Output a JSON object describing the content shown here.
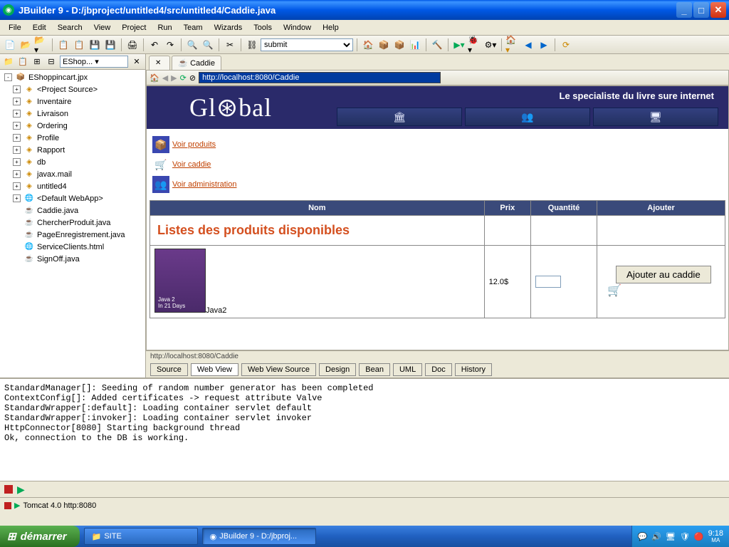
{
  "title": "JBuilder 9 - D:/jbproject/untitled4/src/untitled4/Caddie.java",
  "menu": [
    "File",
    "Edit",
    "Search",
    "View",
    "Project",
    "Run",
    "Team",
    "Wizards",
    "Tools",
    "Window",
    "Help"
  ],
  "combo_toolbar": "submit",
  "sidebar_combo": "EShop...",
  "tree": [
    {
      "exp": "-",
      "icon": "jar",
      "label": "EShoppincart.jpx"
    },
    {
      "exp": "+",
      "icon": "pkg",
      "label": "<Project Source>",
      "indent": 1
    },
    {
      "exp": "+",
      "icon": "pkg",
      "label": "Inventaire",
      "indent": 1
    },
    {
      "exp": "+",
      "icon": "pkg",
      "label": "Livraison",
      "indent": 1
    },
    {
      "exp": "+",
      "icon": "pkg",
      "label": "Ordering",
      "indent": 1
    },
    {
      "exp": "+",
      "icon": "pkg",
      "label": "Profile",
      "indent": 1
    },
    {
      "exp": "+",
      "icon": "pkg",
      "label": "Rapport",
      "indent": 1
    },
    {
      "exp": "+",
      "icon": "pkg",
      "label": "db",
      "indent": 1
    },
    {
      "exp": "+",
      "icon": "pkg",
      "label": "javax.mail",
      "indent": 1
    },
    {
      "exp": "+",
      "icon": "pkg",
      "label": "untitled4",
      "indent": 1
    },
    {
      "exp": "+",
      "icon": "web",
      "label": "<Default WebApp>",
      "indent": 1
    },
    {
      "exp": "",
      "icon": "java",
      "label": "Caddie.java",
      "indent": 1
    },
    {
      "exp": "",
      "icon": "java",
      "label": "ChercherProduit.java",
      "indent": 1
    },
    {
      "exp": "",
      "icon": "java",
      "label": "PageEnregistrement.java",
      "indent": 1
    },
    {
      "exp": "",
      "icon": "html",
      "label": "ServiceClients.html",
      "indent": 1
    },
    {
      "exp": "",
      "icon": "java",
      "label": "SignOff.java",
      "indent": 1
    }
  ],
  "tab_label": "Caddie",
  "address_bar": "http://localhost:8080/Caddie",
  "web": {
    "logo": "Gl⊛bal",
    "tagline": "Le specialiste du livre sure internet",
    "links": [
      {
        "icon": "📦",
        "label": "Voir produits"
      },
      {
        "icon": "🛒",
        "label": "Voir caddie",
        "cart": true
      },
      {
        "icon": "👥",
        "label": "Voir administration"
      }
    ],
    "table_headers": {
      "nom": "Nom",
      "prix": "Prix",
      "qte": "Quantité",
      "ajouter": "Ajouter"
    },
    "subhead": "Listes des produits disponibles",
    "products": [
      {
        "name": "Java2",
        "price": "12.0$",
        "add_label": "Ajouter au caddie"
      }
    ]
  },
  "status_url": "http://localhost:8080/Caddie",
  "bottom_tabs": [
    "Source",
    "Web View",
    "Web View Source",
    "Design",
    "Bean",
    "UML",
    "Doc",
    "History"
  ],
  "active_bottom_tab": "Web View",
  "console_lines": "StandardManager[]: Seeding of random number generator has been completed\nContextConfig[]: Added certificates -> request attribute Valve\nStandardWrapper[:default]: Loading container servlet default\nStandardWrapper[:invoker]: Loading container servlet invoker\nHttpConnector[8080] Starting background thread\nOk, connection to the DB is working.",
  "server_tab": "Tomcat 4.0 http:8080",
  "taskbar": {
    "start": "démarrer",
    "tasks": [
      {
        "label": "SITE",
        "active": false,
        "icon": "📁"
      },
      {
        "label": "JBuilder 9 - D:/jbproj...",
        "active": true,
        "icon": "◉"
      }
    ],
    "clock_time": "9:18",
    "clock_ampm": "MA"
  }
}
